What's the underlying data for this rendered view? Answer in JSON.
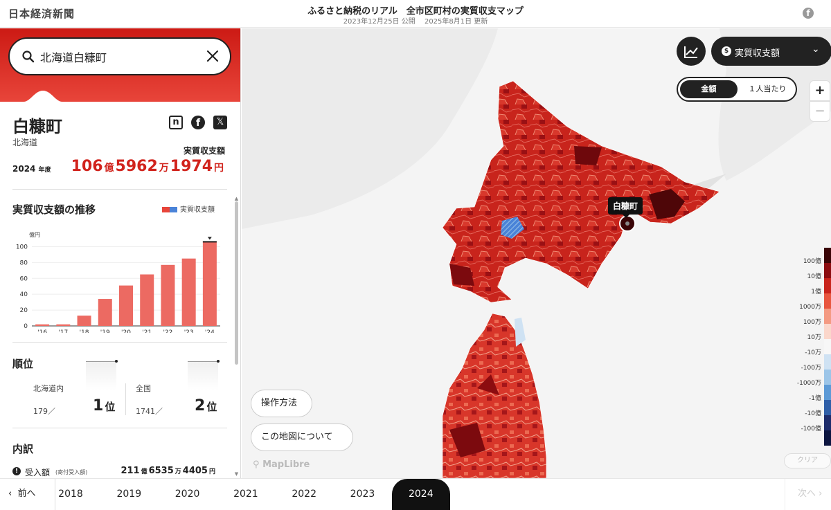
{
  "header": {
    "logo": "日本経済新聞",
    "title": "ふるさと納税のリアル　全市区町村の実質収支マップ",
    "published": "2023年12月25日 公開",
    "updated": "2025年8月1日 更新"
  },
  "search": {
    "value": "北海道白糠町",
    "placeholder": ""
  },
  "place": {
    "name": "白糠町",
    "prefecture": "北海道",
    "share_note": "n",
    "net_label": "実質収支額",
    "fiscal_year": "2024",
    "fiscal_year_suffix": "年度",
    "net_oku": "106",
    "net_man": "5962",
    "net_en": "1974",
    "unit_oku": "億",
    "unit_man": "万",
    "unit_en": "円"
  },
  "trend": {
    "title": "実質収支額の推移",
    "legend": "実質収支額"
  },
  "chart_data": {
    "type": "bar",
    "categories": [
      "'16",
      "'17",
      "'18",
      "'19",
      "'20",
      "'21",
      "'22",
      "'23",
      "'24"
    ],
    "values": [
      2,
      2,
      13,
      34,
      51,
      65,
      77,
      85,
      107
    ],
    "ylabel": "億円",
    "yticks": [
      0,
      20,
      40,
      60,
      80,
      100
    ],
    "ylim": [
      0,
      110
    ],
    "highlight": "'24"
  },
  "rank": {
    "title": "順位",
    "pref_label": "北海道内",
    "pref_total": "179／",
    "pref_rank": "1",
    "national_label": "全国",
    "national_total": "1741／",
    "national_rank": "2",
    "unit": "位"
  },
  "breakdown": {
    "title": "内訳",
    "income_label": "受入額",
    "income_note": "(寄付受入額)",
    "income_oku": "211",
    "income_man": "6535",
    "income_en": "4405",
    "unit_oku": "億",
    "unit_man": "万",
    "unit_en": "円"
  },
  "map": {
    "metric_select": "実質収支額",
    "toggle_amount": "金額",
    "toggle_percap": "１人当たり",
    "zoom_in": "+",
    "zoom_out": "−",
    "howto": "操作方法",
    "about": "この地図について",
    "attribution": "MapLibre",
    "clear": "クリア",
    "selected_label": "白糠町",
    "scale": [
      "100億",
      "10億",
      "1億",
      "1000万",
      "100万",
      "10万",
      "-10万",
      "-100万",
      "-1000万",
      "-1億",
      "-10億",
      "-100億"
    ],
    "scale_colors": [
      "#3a0507",
      "#8c0c10",
      "#c8241c",
      "#e8563f",
      "#f49a82",
      "#fbd7cb",
      "#f7f7f7",
      "#cfe2f3",
      "#9cc5e8",
      "#5d9ad6",
      "#2f5fa8",
      "#1d2c6b",
      "#0c1540"
    ]
  },
  "years": {
    "prev": "前へ",
    "next": "次へ",
    "items": [
      "2018",
      "2019",
      "2020",
      "2021",
      "2022",
      "2023",
      "2024"
    ],
    "active": "2024"
  },
  "colors": {
    "accent": "#d1231c",
    "dark": "#222222"
  }
}
